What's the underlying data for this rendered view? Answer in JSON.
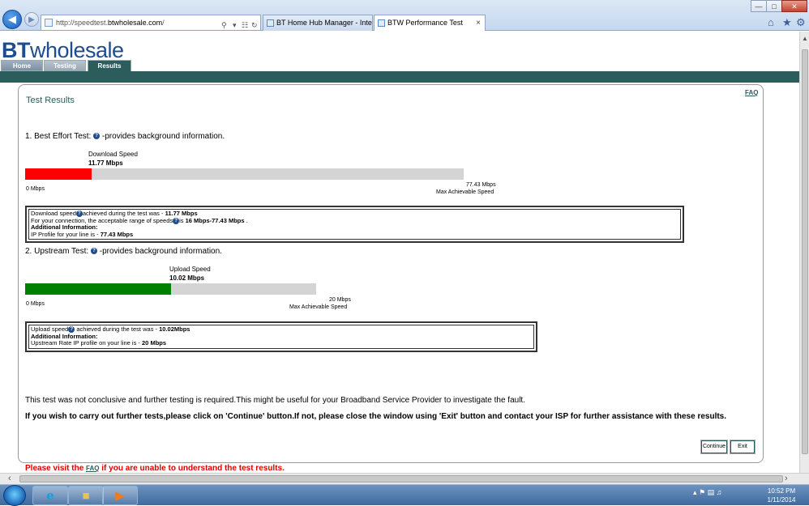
{
  "browser": {
    "url_prefix": "http://speedtest.",
    "url_host": "btwholesale.com",
    "url_suffix": "/",
    "tabs": [
      {
        "label": "BT Home Hub Manager - Inter..."
      },
      {
        "label": "BTW Performance Test"
      }
    ],
    "close_tab_glyph": "×"
  },
  "site": {
    "logo_bt": "BT",
    "logo_rest": "wholesale",
    "nav": [
      {
        "label": "Home"
      },
      {
        "label": "Testing"
      },
      {
        "label": "Results"
      }
    ],
    "active_nav": "Results"
  },
  "panel": {
    "title": "Test Results",
    "faq": "FAQ"
  },
  "best_effort": {
    "heading_prefix": "1. Best Effort Test:",
    "heading_suffix": "-provides background information.",
    "bar_label": "Download Speed",
    "bar_value": "11.77 Mbps",
    "min_label": "0 Mbps",
    "max_value": "77.43 Mbps",
    "max_label": "Max Achievable Speed",
    "fill_fraction": 0.152,
    "fill_color": "#ff0000",
    "info_line1_pre": "Download speed",
    "info_line1_mid": "achieved during the test was - ",
    "info_line1_val": "11.77 Mbps",
    "info_line2_pre": "For your connection, the acceptable range of speeds",
    "info_line2_mid": "is ",
    "info_line2_val": "16 Mbps-77.43 Mbps",
    "info_line2_post": " .",
    "info_line3": "Additional Information:",
    "info_line4_pre": "IP Profile for your line is - ",
    "info_line4_val": "77.43 Mbps"
  },
  "upstream": {
    "heading_prefix": "2. Upstream Test:",
    "heading_suffix": "-provides background information.",
    "bar_label": "Upload Speed",
    "bar_value": "10.02 Mbps",
    "min_label": "0 Mbps",
    "max_value": "20 Mbps",
    "max_label": "Max Achievable Speed",
    "fill_fraction": 0.501,
    "fill_color": "#008000",
    "info_line1_pre": "Upload speed",
    "info_line1_mid": " achieved during the test was - ",
    "info_line1_val": "10.02Mbps",
    "info_line2": "Additional Information:",
    "info_line3_pre": "Upstream Rate IP profile on your line is - ",
    "info_line3_val": "20 Mbps"
  },
  "result_message": "This test was not conclusive and further testing is required.This might be useful for your Broadband Service Provider to investigate the fault.",
  "instruction": "If you wish to carry out further tests,please click on 'Continue' button.If not, please close the window using 'Exit' button and contact your ISP for further assistance with these results.",
  "buttons": {
    "continue": "Continue",
    "exit": "Exit"
  },
  "faq_note": {
    "pre": "Please visit the ",
    "link": "FAQ",
    "post": " if you are unable to understand the test results."
  },
  "taskbar": {
    "time": "10:52 PM",
    "date": "1/11/2014"
  },
  "colors": {
    "brand": "#1e4c8f",
    "teal": "#2d5c5c"
  }
}
